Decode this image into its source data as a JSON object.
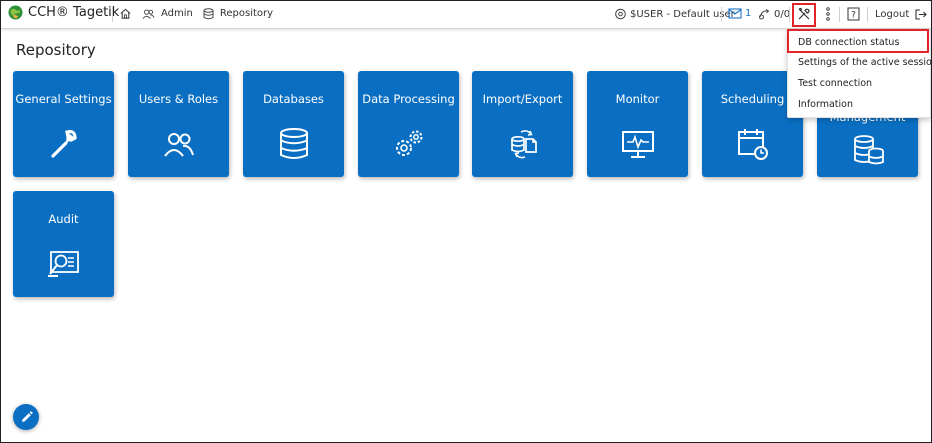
{
  "header": {
    "brand": "CCH® Tagetik",
    "nav": {
      "admin": "Admin",
      "repository": "Repository"
    },
    "user": "$USER - Default user",
    "mail_count": "1",
    "tasks": "0/0",
    "logout": "Logout"
  },
  "page": {
    "title": "Repository"
  },
  "tiles": [
    {
      "label": "General Settings",
      "icon": "wrench-icon"
    },
    {
      "label": "Users & Roles",
      "icon": "users-icon"
    },
    {
      "label": "Databases",
      "icon": "database-icon"
    },
    {
      "label": "Data Processing",
      "icon": "gears-icon"
    },
    {
      "label": "Import/Export",
      "icon": "import-export-icon"
    },
    {
      "label": "Monitor",
      "icon": "monitor-icon"
    },
    {
      "label": "Scheduling",
      "icon": "calendar-clock-icon"
    },
    {
      "label": "Management",
      "icon": "multi-database-icon"
    },
    {
      "label": "Audit",
      "icon": "audit-icon"
    }
  ],
  "dropdown": {
    "items": [
      "DB connection status",
      "Settings of the active session",
      "Test connection",
      "Information"
    ]
  },
  "colors": {
    "tile": "#0a6fc2",
    "highlight": "#e0242a",
    "accent": "#1a73c8"
  }
}
